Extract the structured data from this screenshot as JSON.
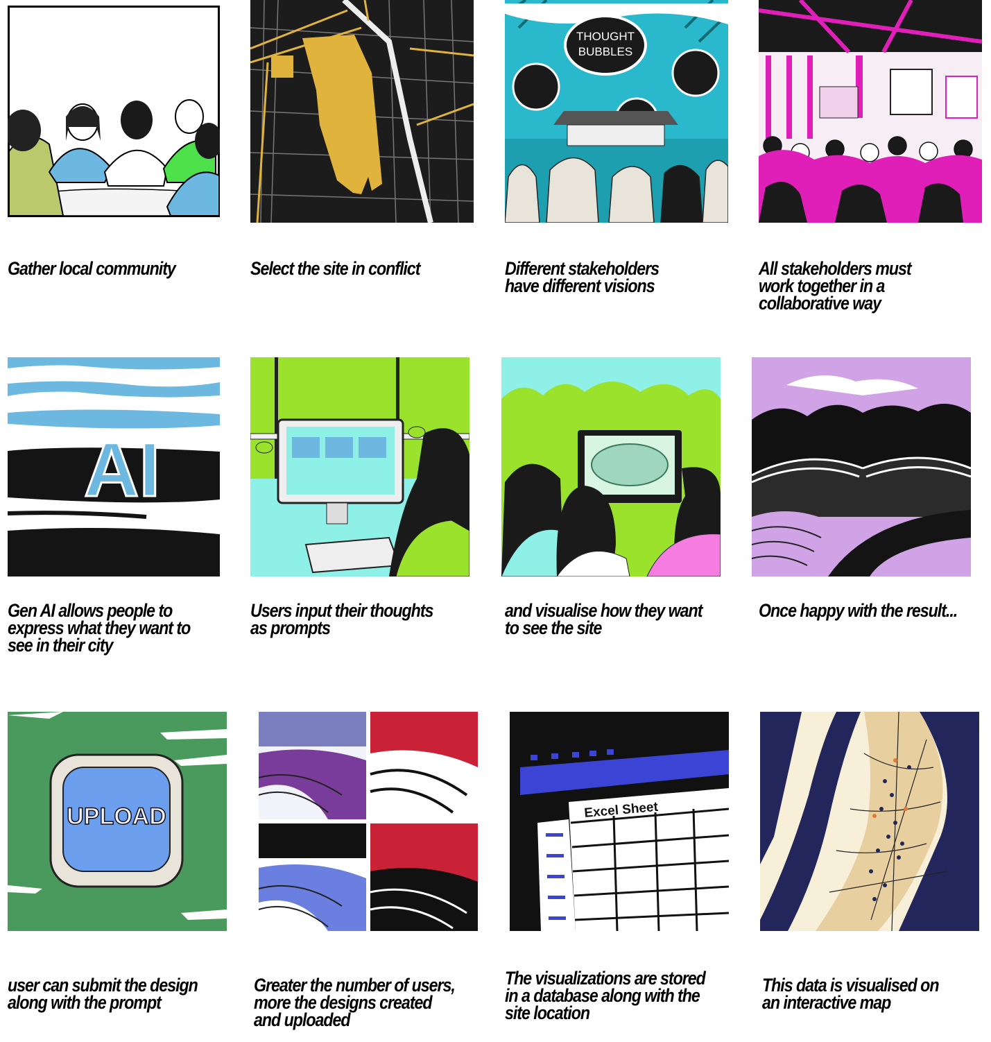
{
  "storyboard": {
    "panels": [
      {
        "id": "community",
        "caption": "Gather local community",
        "icon": "community-meeting-illustration"
      },
      {
        "id": "site",
        "caption": "Select the site in conflict",
        "icon": "site-map-illustration"
      },
      {
        "id": "visions",
        "caption": "Different stakeholders\nhave different visions",
        "icon": "thought-bubbles-illustration",
        "art_text": "THOUGHT BUBBLES"
      },
      {
        "id": "collab",
        "caption": "All stakeholders must\nwork together in a\ncollaborative way",
        "icon": "workshop-presentation-illustration"
      },
      {
        "id": "genai",
        "caption": "Gen AI allows people to\nexpress what they want to\nsee in their city",
        "icon": "ai-letters-illustration",
        "art_text": "AI"
      },
      {
        "id": "prompts",
        "caption": "Users input their thoughts\nas prompts",
        "icon": "computer-user-illustration"
      },
      {
        "id": "visualise",
        "caption": "and visualise how they want\nto see the site",
        "icon": "viewing-screen-illustration"
      },
      {
        "id": "result",
        "caption": "Once happy with the result...",
        "icon": "landscape-result-illustration"
      },
      {
        "id": "upload",
        "caption": "user can submit the design\nalong with the prompt",
        "icon": "upload-button-illustration",
        "art_text": "UPLOAD"
      },
      {
        "id": "designs",
        "caption": "Greater the number of users,\nmore the designs created\nand uploaded",
        "icon": "design-grid-illustration"
      },
      {
        "id": "database",
        "caption": "The visualizations are stored\nin a database along with the\nsite location",
        "icon": "spreadsheet-illustration",
        "art_text": "Excel Sheet"
      },
      {
        "id": "map",
        "caption": "This data is visualised on\nan interactive map",
        "icon": "interactive-map-illustration"
      }
    ]
  },
  "colors": {
    "magenta": "#e01fb8",
    "lime": "#9be22d",
    "aqua": "#8ff0e8",
    "sky": "#6cb8e0",
    "mustard": "#e0b43c",
    "green": "#4a9a5e",
    "navy": "#22265a",
    "lavender": "#cfa3e6",
    "blue": "#3c44d6",
    "red": "#c92236"
  }
}
